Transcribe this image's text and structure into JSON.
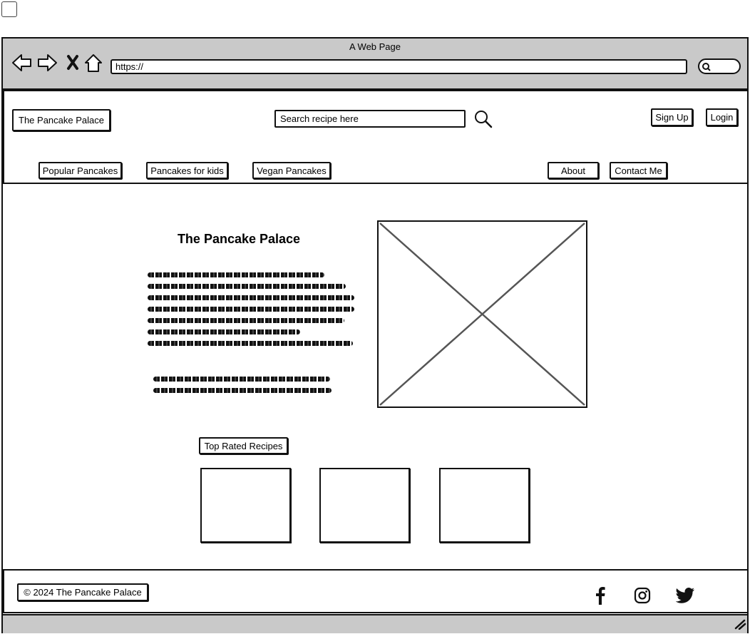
{
  "window": {
    "title": "A Web Page",
    "url": "https://"
  },
  "header": {
    "logo": "The Pancake Palace",
    "search": {
      "value": "Search recipe here"
    },
    "actions": {
      "signup": "Sign Up",
      "login": "Login"
    },
    "nav": {
      "left": [
        "Popular Pancakes",
        "Pancakes for kids",
        "Vegan Pancakes"
      ],
      "right": [
        "About",
        "Contact Me"
      ]
    }
  },
  "main": {
    "title": "The Pancake Palace",
    "top_rated_label": "Top Rated Recipes"
  },
  "footer": {
    "copyright": "© 2024 The Pancake Palace",
    "social_icons": [
      "facebook-icon",
      "instagram-icon",
      "twitter-icon"
    ]
  }
}
